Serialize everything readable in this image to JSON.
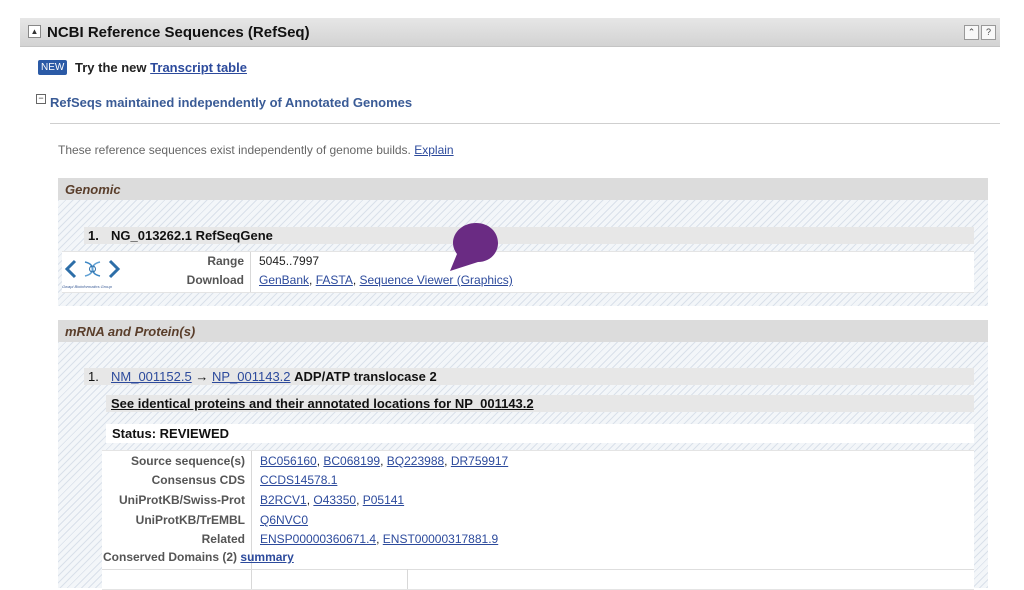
{
  "panel": {
    "title": "NCBI Reference Sequences (RefSeq)",
    "toggle_glyph": "▲",
    "btn_top": "⌃",
    "btn_help": "?"
  },
  "banner": {
    "badge": "NEW",
    "try_text": "Try the new",
    "link": "Transcript table"
  },
  "section": {
    "collapse_glyph": "−",
    "title": "RefSeqs maintained independently of Annotated Genomes"
  },
  "explain": {
    "text": "These reference sequences exist independently of genome builds.",
    "link": "Explain"
  },
  "genomic": {
    "header": "Genomic",
    "item_num": "1.",
    "item_title": "NG_013262.1 RefSeqGene",
    "logo_caption": "Gwapi Bioinformatics Group",
    "range_label": "Range",
    "range_value": "5045..7997",
    "download_label": "Download",
    "downloads": [
      "GenBank",
      "FASTA",
      "Sequence Viewer (Graphics)"
    ]
  },
  "mrna": {
    "header": "mRNA and Protein(s)",
    "item_num": "1.",
    "nm": "NM_001152.5",
    "arrow": "→",
    "np": "NP_001143.2",
    "desc": "ADP/ATP translocase 2",
    "identical_link": "See identical proteins and their annotated locations for NP_001143.2",
    "status": "Status: REVIEWED",
    "rows": [
      {
        "label": "Source sequence(s)",
        "links": [
          "BC056160",
          "BC068199",
          "BQ223988",
          "DR759917"
        ]
      },
      {
        "label": "Consensus CDS",
        "links": [
          "CCDS14578.1"
        ]
      },
      {
        "label": "UniProtKB/Swiss-Prot",
        "links": [
          "B2RCV1",
          "O43350",
          "P05141"
        ]
      },
      {
        "label": "UniProtKB/TrEMBL",
        "links": [
          "Q6NVC0"
        ]
      },
      {
        "label": "Related",
        "links": [
          "ENSP00000360671.4",
          "ENST00000317881.9"
        ]
      }
    ],
    "conserved_label": "Conserved Domains (2)",
    "conserved_link": "summary"
  },
  "colors": {
    "link": "#2c4a9c",
    "section_title": "#3a5b96",
    "badge": "#2b5aa6",
    "bubble": "#6a2b83"
  }
}
